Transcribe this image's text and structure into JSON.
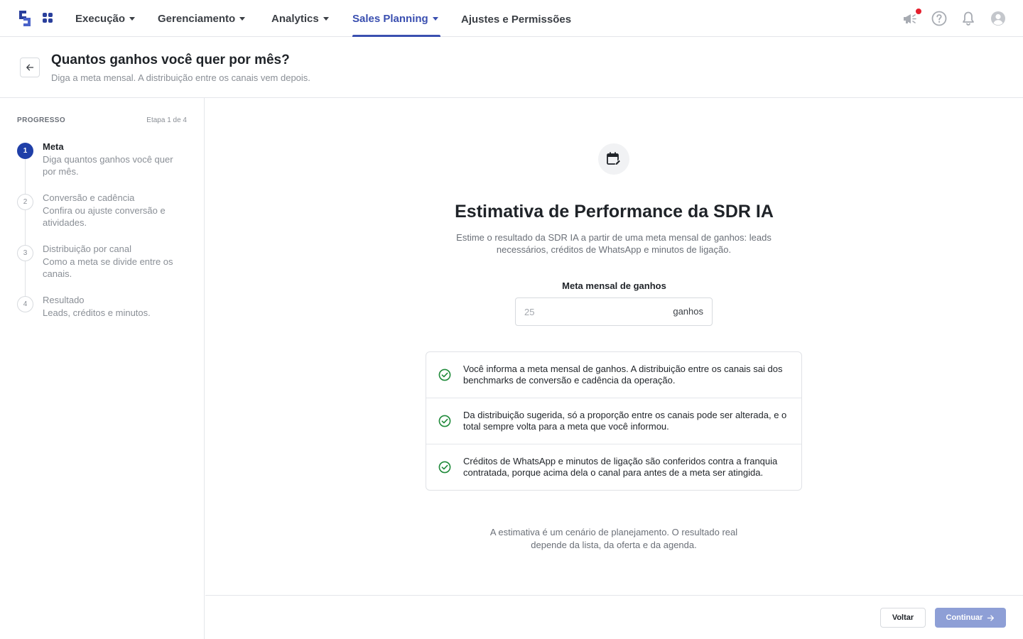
{
  "nav": {
    "items": [
      {
        "label": "Execução",
        "has_caret": true
      },
      {
        "label": "Gerenciamento",
        "has_caret": true
      },
      {
        "label": "Analytics",
        "has_caret": true
      },
      {
        "label": "Sales Planning",
        "has_caret": true,
        "active": true
      },
      {
        "label": "Ajustes e Permissões",
        "has_caret": false
      }
    ],
    "accent_color": "#3a4fb0",
    "right_icons": [
      "megaphone-icon",
      "help-icon",
      "bell-icon",
      "user-avatar-icon"
    ],
    "notification_dot_color": "#e5202e"
  },
  "header": {
    "title": "Quantos ganhos você quer por mês?",
    "subtitle": "Diga a meta mensal. A distribuição entre os canais vem depois."
  },
  "sidebar": {
    "progress_label": "PROGRESSO",
    "stage_label": "Etapa 1 de 4",
    "steps": [
      {
        "number": "1",
        "title": "Meta",
        "description": "Diga quantos ganhos você quer por mês.",
        "current": true
      },
      {
        "number": "2",
        "title": "Conversão e cadência",
        "description": "Confira ou ajuste conversão e atividades."
      },
      {
        "number": "3",
        "title": "Distribuição por canal",
        "description": "Como a meta se divide entre os canais."
      },
      {
        "number": "4",
        "title": "Resultado",
        "description": "Leads, créditos e minutos."
      }
    ]
  },
  "main": {
    "icon": "calendar-edit-icon",
    "title": "Estimativa de Performance da SDR IA",
    "description": "Estime o resultado da SDR IA a partir de uma meta mensal de ganhos: leads necessários, créditos de WhatsApp e minutos de ligação.",
    "field": {
      "label": "Meta mensal de ganhos",
      "value": "",
      "placeholder": "25",
      "suffix": "ganhos"
    },
    "info": [
      "Você informa a meta mensal de ganhos. A distribuição entre os canais sai dos benchmarks de conversão e cadência da operação.",
      "Da distribuição sugerida, só a proporção entre os canais pode ser alterada, e o total sempre volta para a meta que você informou.",
      "Créditos de WhatsApp e minutos de ligação são conferidos contra a franquia contratada, porque acima dela o canal para antes de a meta ser atingida."
    ],
    "check_color": "#1f8a3a",
    "footnote": "A estimativa é um cenário de planejamento. O resultado real depende da lista, da oferta e da agenda."
  },
  "footer": {
    "back_label": "Voltar",
    "continue_label": "Continuar",
    "continue_color": "#8e9fd6"
  }
}
